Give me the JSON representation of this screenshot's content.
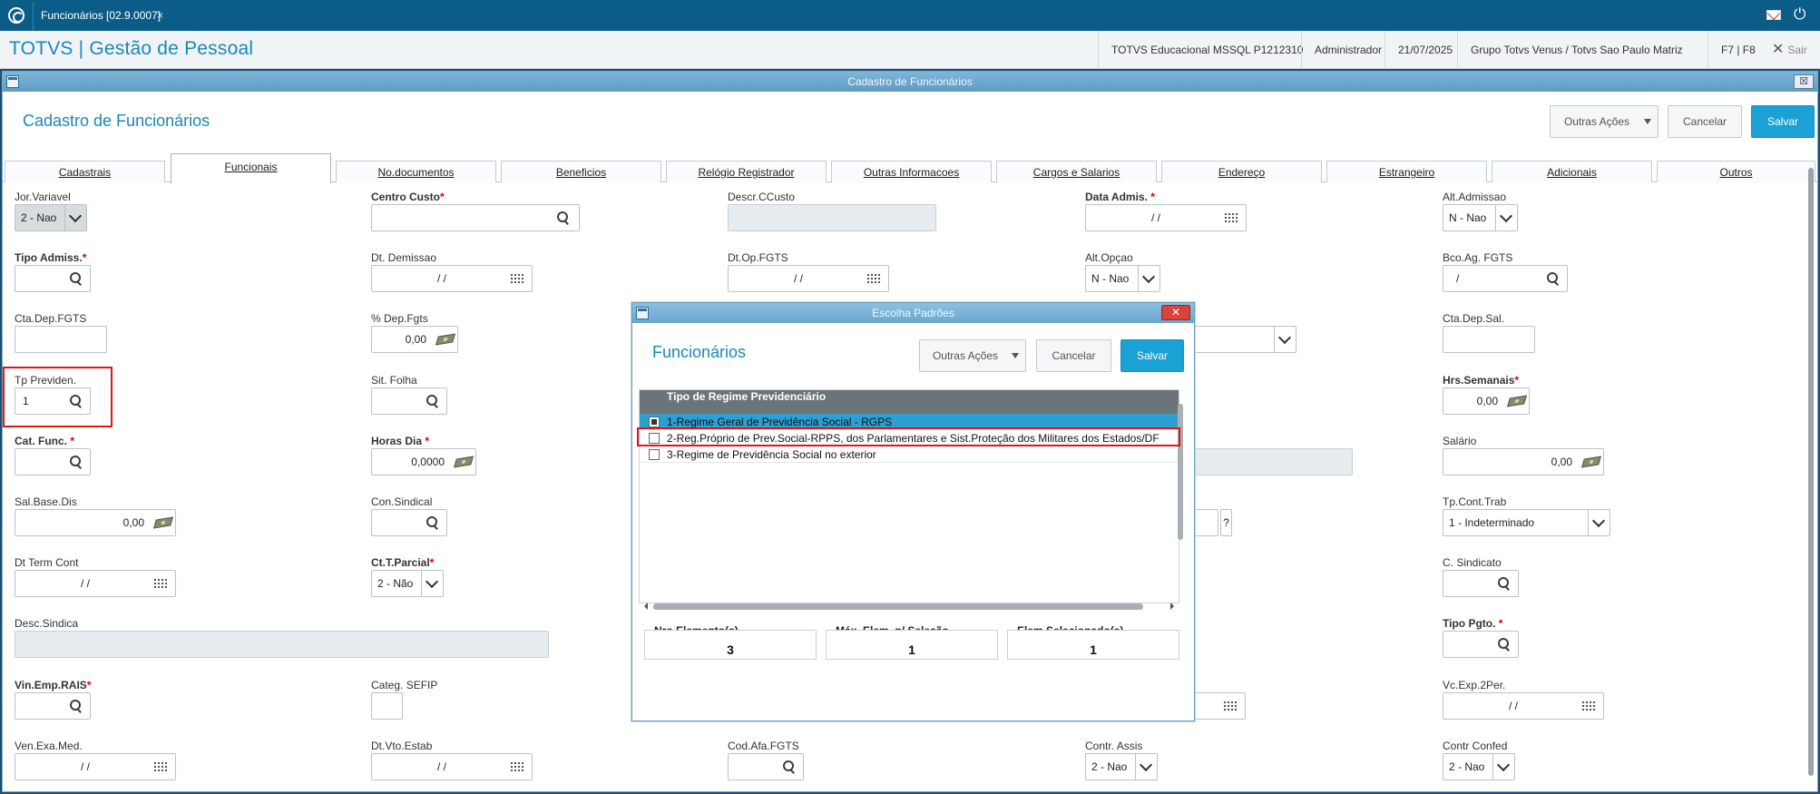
{
  "topbar": {
    "tab_title": "Funcionários [02.9.0007]",
    "tab_close": "×"
  },
  "header": {
    "brand": "TOTVS | Gestão de Pessoal",
    "environment": "TOTVS Educacional MSSQL P1212310",
    "user": "Administrador",
    "date": "21/07/2025",
    "company": "Grupo Totvs Venus / Totvs Sao Paulo Matriz",
    "shortcuts": "F7 | F8",
    "logout": "Sair",
    "logout_icon": "✕"
  },
  "window": {
    "title": "Cadastro de Funcionários",
    "close": "☒",
    "page_title": "Cadastro de Funcionários",
    "other_actions": "Outras Ações",
    "cancel": "Cancelar",
    "save": "Salvar"
  },
  "tabs": [
    {
      "label": "Cadastrais"
    },
    {
      "label": "Funcionais"
    },
    {
      "label": "No.documentos"
    },
    {
      "label": "Beneficios"
    },
    {
      "label": "Relógio Registrador"
    },
    {
      "label": "Outras Informacoes"
    },
    {
      "label": "Cargos e Salarios"
    },
    {
      "label": "Endereço"
    },
    {
      "label": "Estrangeiro"
    },
    {
      "label": "Adicionais"
    },
    {
      "label": "Outros"
    }
  ],
  "form": {
    "jor_variavel": {
      "label": "Jor.Variavel",
      "value": "2 - Nao"
    },
    "centro_custo": {
      "label": "Centro Custo",
      "req": "*"
    },
    "descr_ccusto": {
      "label": "Descr.CCusto"
    },
    "data_admis": {
      "label": "Data Admis.",
      "req": "*",
      "value": "/ /"
    },
    "alt_admissao": {
      "label": "Alt.Admissao",
      "value": "N - Nao"
    },
    "tipo_admiss": {
      "label": "Tipo Admiss.",
      "req": "*"
    },
    "dt_demissao": {
      "label": "Dt. Demissao",
      "value": "/ /"
    },
    "dt_op_fgts": {
      "label": "Dt.Op.FGTS",
      "value": "/ /"
    },
    "alt_opcao": {
      "label": "Alt.Opçao",
      "value": "N - Nao"
    },
    "bco_ag_fgts": {
      "label": "Bco.Ag. FGTS",
      "value": "/"
    },
    "cta_dep_fgts": {
      "label": "Cta.Dep.FGTS"
    },
    "pct_dep_fgts": {
      "label": "% Dep.Fgts",
      "value": "0,00"
    },
    "cta_dep_sal": {
      "label": "Cta.Dep.Sal."
    },
    "tp_previden": {
      "label": "Tp Previden.",
      "value": "1"
    },
    "sit_folha": {
      "label": "Sit. Folha"
    },
    "hrs_semanais": {
      "label": "Hrs.Semanais",
      "req": "*",
      "value": "0,00"
    },
    "cat_func": {
      "label": "Cat. Func.",
      "req": "*"
    },
    "horas_dia": {
      "label": "Horas Dia",
      "req": "*",
      "value": "0,0000"
    },
    "salario": {
      "label": "Salário",
      "value": "0,00"
    },
    "sal_base_dis": {
      "label": "Sal.Base.Dis",
      "value": "0,00"
    },
    "con_sindical": {
      "label": "Con.Sindical"
    },
    "tp_cont_trab": {
      "label": "Tp.Cont.Trab",
      "value": "1 - Indeterminado"
    },
    "dt_term_cont": {
      "label": "Dt Term Cont",
      "value": "/ /"
    },
    "ct_t_parcial": {
      "label": "Ct.T.Parcial",
      "req": "*",
      "value": "2 - Não"
    },
    "c_sindicato": {
      "label": "C. Sindicato"
    },
    "desc_sindica": {
      "label": "Desc.Sindica"
    },
    "tipo_pgto": {
      "label": "Tipo Pgto.",
      "req": "*"
    },
    "vin_emp_rais": {
      "label": "Vin.Emp.RAIS",
      "req": "*"
    },
    "categ_sefip": {
      "label": "Categ. SEFIP"
    },
    "vc_exp_2per": {
      "label": "Vc.Exp.2Per.",
      "value": "/ /"
    },
    "ven_exa_med": {
      "label": "Ven.Exa.Med.",
      "value": "/ /"
    },
    "dt_vto_estab": {
      "label": "Dt.Vto.Estab",
      "value": "/ /"
    },
    "cod_afa_fgts": {
      "label": "Cod.Afa.FGTS"
    },
    "contr_assis": {
      "label": "Contr. Assis",
      "value": "2 - Nao"
    },
    "contr_confed": {
      "label": "Contr Confed",
      "value": "2 - Nao"
    },
    "hidden_help": "?"
  },
  "modal": {
    "title": "Escolha Padrões",
    "close": "✕",
    "heading": "Funcionários",
    "other_actions": "Outras Ações",
    "cancel": "Cancelar",
    "save": "Salvar",
    "grid_header": "Tipo de Regime Previdenciário",
    "rows": [
      {
        "label": "1-Regime Geral de Previdência Social - RGPS",
        "checked": true
      },
      {
        "label": "2-Reg.Próprio de Prev.Social-RPPS, dos Parlamentares e Sist.Proteção dos Militares dos Estados/DF",
        "checked": false
      },
      {
        "label": "3-Regime de Previdência Social no exterior",
        "checked": false
      }
    ],
    "nro_label": "Nro.Elemento(s)",
    "nro_value": "3",
    "max_label": "Máx. Elem. p/ Seleção",
    "max_value": "1",
    "sel_label": "Elem.Selecionado(s)",
    "sel_value": "1"
  },
  "colors": {
    "accent": "#1a87b9",
    "primary_button": "#1ba1d3",
    "highlight": "#e01616"
  }
}
